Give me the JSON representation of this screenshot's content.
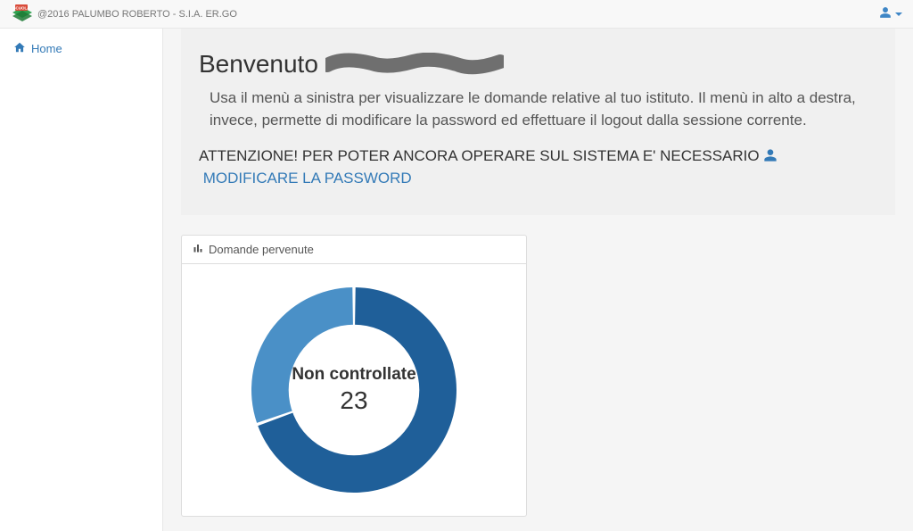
{
  "topbar": {
    "brand_text": "@2016 PALUMBO ROBERTO - S.I.A. ER.GO"
  },
  "sidebar": {
    "items": [
      {
        "label": "Home"
      }
    ]
  },
  "hero": {
    "welcome": "Benvenuto",
    "lead": "Usa il menù a sinistra per visualizzare le domande relative al tuo istituto. Il menù in alto a destra, invece, permette di modificare la password ed effettuare il logout dalla sessione corrente.",
    "attention_prefix": "ATTENZIONE! PER POTER ANCORA OPERARE SUL SISTEMA E' NECESSARIO",
    "modify_link": "MODIFICARE LA PASSWORD"
  },
  "panel": {
    "title": "Domande pervenute",
    "center_label": "Non controllate",
    "center_value": "23"
  },
  "chart_data": {
    "type": "pie",
    "title": "Domande pervenute",
    "series": [
      {
        "name": "Non controllate (dark)",
        "value": 16,
        "color": "#1f5f99"
      },
      {
        "name": "Non controllate (light)",
        "value": 7,
        "color": "#4a90c7"
      }
    ],
    "center_label": "Non controllate",
    "center_value": 23,
    "donut_inner_ratio": 0.62
  }
}
